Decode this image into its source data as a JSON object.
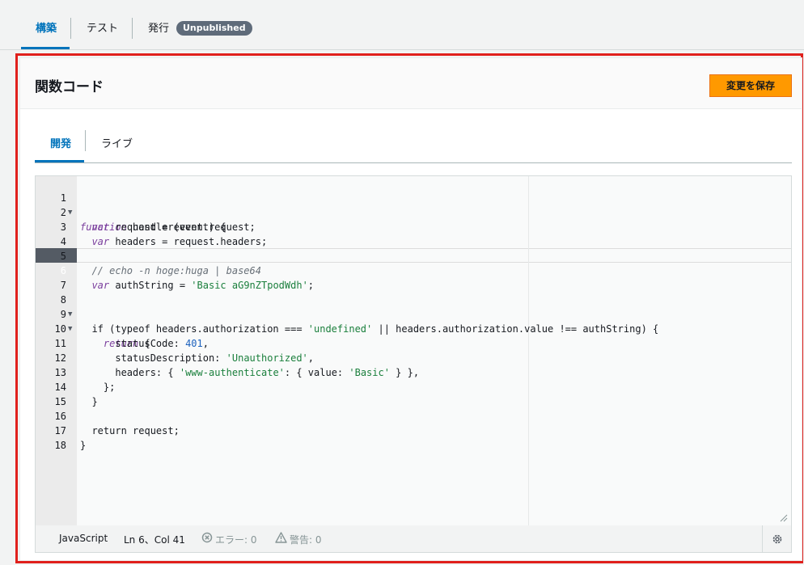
{
  "top_tabs": {
    "build": "構築",
    "test": "テスト",
    "publish": "発行",
    "badge": "Unpublished"
  },
  "panel": {
    "title": "関数コード",
    "save_button": "変更を保存"
  },
  "inner_tabs": {
    "dev": "開発",
    "live": "ライブ"
  },
  "editor": {
    "lines": [
      {
        "n": "1"
      },
      {
        "n": "2"
      },
      {
        "n": "3"
      },
      {
        "n": "4"
      },
      {
        "n": "5"
      },
      {
        "n": "6"
      },
      {
        "n": "7"
      },
      {
        "n": "8"
      },
      {
        "n": "9"
      },
      {
        "n": "10"
      },
      {
        "n": "11"
      },
      {
        "n": "12"
      },
      {
        "n": "13"
      },
      {
        "n": "14"
      },
      {
        "n": "15"
      },
      {
        "n": "16"
      },
      {
        "n": "17"
      },
      {
        "n": "18"
      }
    ],
    "code": {
      "l1_kw": "function",
      "l1_rest": " handler(event) {",
      "l2_kw": "var",
      "l2_rest": " request = event.request;",
      "l3_kw": "var",
      "l3_rest": " headers = request.headers;",
      "l5_comment": "// echo -n hoge:huga | base64",
      "l6_kw": "var",
      "l6_a": " authString = ",
      "l6_str": "'Basic aG9nZTpodWdh'",
      "l6_end": ";",
      "l8_a": "if (typeof headers.authorization === ",
      "l8_str": "'undefined'",
      "l8_b": " || headers.authorization.value !== authString) {",
      "l9_kw": "return",
      "l9_rest": " {",
      "l10_a": "statusCode: ",
      "l10_num": "401",
      "l10_b": ",",
      "l11_a": "statusDescription: ",
      "l11_str": "'Unauthorized'",
      "l11_b": ",",
      "l12_a": "headers: { ",
      "l12_str1": "'www-authenticate'",
      "l12_b": ": { value: ",
      "l12_str2": "'Basic'",
      "l12_c": " } },",
      "l13": "};",
      "l14": "}",
      "l16_a": "return request;",
      "l17": "}"
    }
  },
  "status_bar": {
    "language": "JavaScript",
    "position": "Ln 6、Col 41",
    "errors": "エラー: 0",
    "warnings": "警告: 0"
  },
  "icons": {
    "fold": "triangle-down",
    "error": "x-circle",
    "warning": "warning-triangle",
    "settings": "gear"
  },
  "colors": {
    "accent": "#0073bb",
    "save_button": "#ff9900",
    "frame": "#e0201c"
  }
}
